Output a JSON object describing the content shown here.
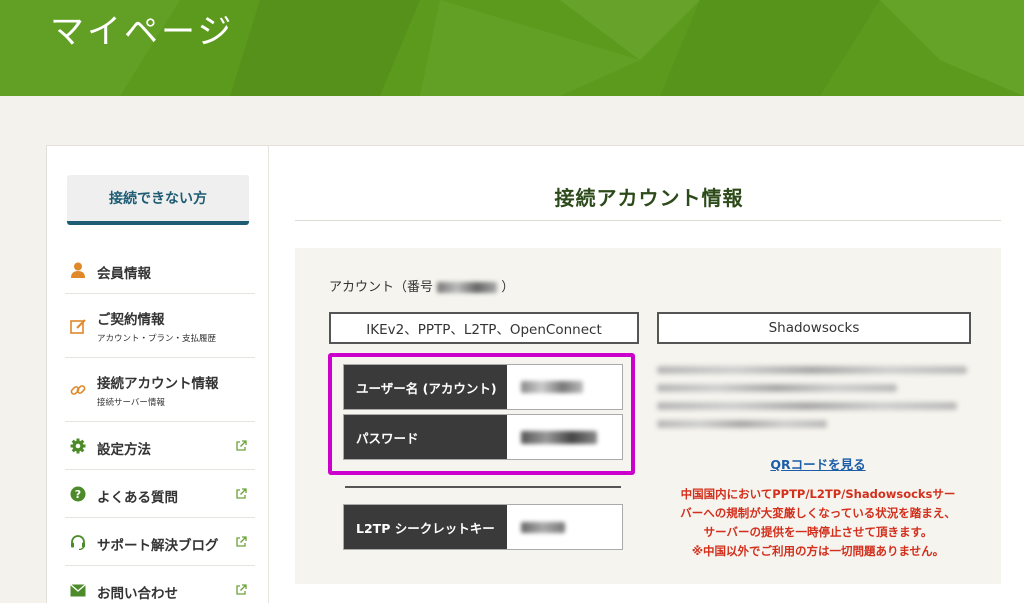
{
  "header": {
    "title": "マイページ"
  },
  "sidebar": {
    "cannot_connect": "接続できない方",
    "items": [
      {
        "label": "会員情報",
        "sub": "",
        "icon": "person-icon",
        "external": false
      },
      {
        "label": "ご契約情報",
        "sub": "アカウント・プラン・支払履歴",
        "icon": "edit-icon",
        "external": false
      },
      {
        "label": "接続アカウント情報",
        "sub": "接続サーバー情報",
        "icon": "link-icon",
        "external": false
      },
      {
        "label": "設定方法",
        "sub": "",
        "icon": "gear-icon",
        "external": true
      },
      {
        "label": "よくある質問",
        "sub": "",
        "icon": "question-icon",
        "external": true
      },
      {
        "label": "サポート解決ブログ",
        "sub": "",
        "icon": "headset-icon",
        "external": true
      },
      {
        "label": "お問い合わせ",
        "sub": "",
        "icon": "mail-icon",
        "external": true
      }
    ]
  },
  "main": {
    "title": "接続アカウント情報",
    "account_prefix": "アカウント（番号",
    "account_suffix": "）",
    "tabs": {
      "protocols": "IKEv2、PPTP、L2TP、OpenConnect",
      "shadowsocks": "Shadowsocks"
    },
    "credentials": {
      "username_label": "ユーザー名 (アカウント)",
      "password_label": "パスワード",
      "l2tp_label": "L2TP シークレットキー"
    },
    "qr_link": "QRコードを見る",
    "warning": [
      "中国国内においてPPTP/L2TP/Shadowsocksサー",
      "バーへの規制が大変厳しくなっている状況を踏まえ、",
      "サーバーの提供を一時停止させて頂きます。",
      "※中国以外でご利用の方は一切問題ありません。"
    ]
  },
  "colors": {
    "header_green": "#5c9a1e",
    "accent_teal": "#1d5c73",
    "icon_orange": "#e0892b",
    "icon_green": "#4d8a2a",
    "highlight_magenta": "#cc00cc",
    "warning_red": "#d32f1d",
    "link_blue": "#1d5da8"
  }
}
